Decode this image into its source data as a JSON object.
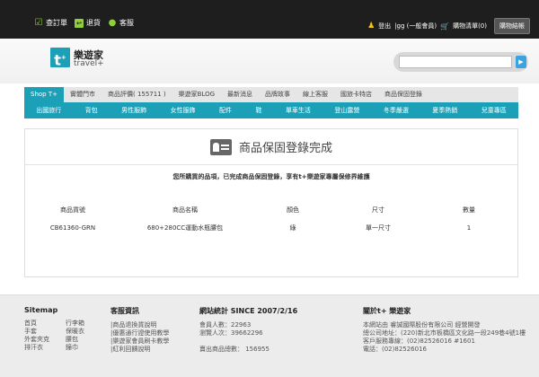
{
  "topbar": {
    "order_label": "查訂單",
    "return_label": "退貨",
    "service_label": "客服",
    "logout_label": "登出",
    "user_info": "|gg (一般會員)",
    "cart_label": "購物清單(0)",
    "checkout_label": "購物結帳"
  },
  "brand": {
    "logo_letter": "t",
    "logo_sup": "+",
    "name_cn": "樂遊家",
    "name_en": "travel+"
  },
  "search": {
    "placeholder": "",
    "button_glyph": "▶"
  },
  "nav1": [
    {
      "label": "Shop T+",
      "active": true
    },
    {
      "label": "實體門市"
    },
    {
      "label": "商品評價( 155711 )"
    },
    {
      "label": "樂遊家BLOG"
    },
    {
      "label": "最新消息"
    },
    {
      "label": "品牌故事"
    },
    {
      "label": "線上客服"
    },
    {
      "label": "國旅卡特店"
    },
    {
      "label": "商品保固登錄"
    }
  ],
  "nav2": [
    "出國旅行",
    "背包",
    "男性服飾",
    "女性服飾",
    "配件",
    "鞋",
    "單車生活",
    "登山露營",
    "冬季嚴選",
    "夏季熱銷",
    "兒童專區"
  ],
  "main": {
    "title": "商品保固登錄完成",
    "message": "您所購買的品項，已完成商品保固登錄，享有t+樂遊家專屬保修界維護",
    "headers": [
      "商品貨號",
      "商品名稱",
      "顏色",
      "尺寸",
      "數量"
    ],
    "rows": [
      [
        "CB61360-GRN",
        "680+280CC運動水瓶腰包",
        "綠",
        "單一尺寸",
        "1"
      ]
    ]
  },
  "footer": {
    "sitemap": {
      "title": "Sitemap",
      "links": [
        "首頁",
        "行李箱",
        "手套",
        "保暖衣",
        "外套夾克",
        "腰包",
        "排汗衣",
        "鐘巾"
      ]
    },
    "service": {
      "title": "客服資訊",
      "links": [
        "|商品退換貨說明",
        "|優惠通行證使用教學",
        "|樂遊家會員刷卡教學",
        "|紅利回饋說明"
      ]
    },
    "stats": {
      "title": "網站統計 SINCE 2007/2/16",
      "members": "會員人數：22963",
      "visits": "瀏覽人次：39662296",
      "sold": "賣出商品總數：  156955"
    },
    "about": {
      "title": "關於t+ 樂遊家",
      "lines": [
        "本網站由 睿誠國際股份有限公司 經營開發",
        "總公司地址：(220)新北市板橋區文化路一段249巷4號1樓",
        "客戶服務專線：(02)82526016 #1601",
        "電話：(02)82526016"
      ]
    }
  }
}
